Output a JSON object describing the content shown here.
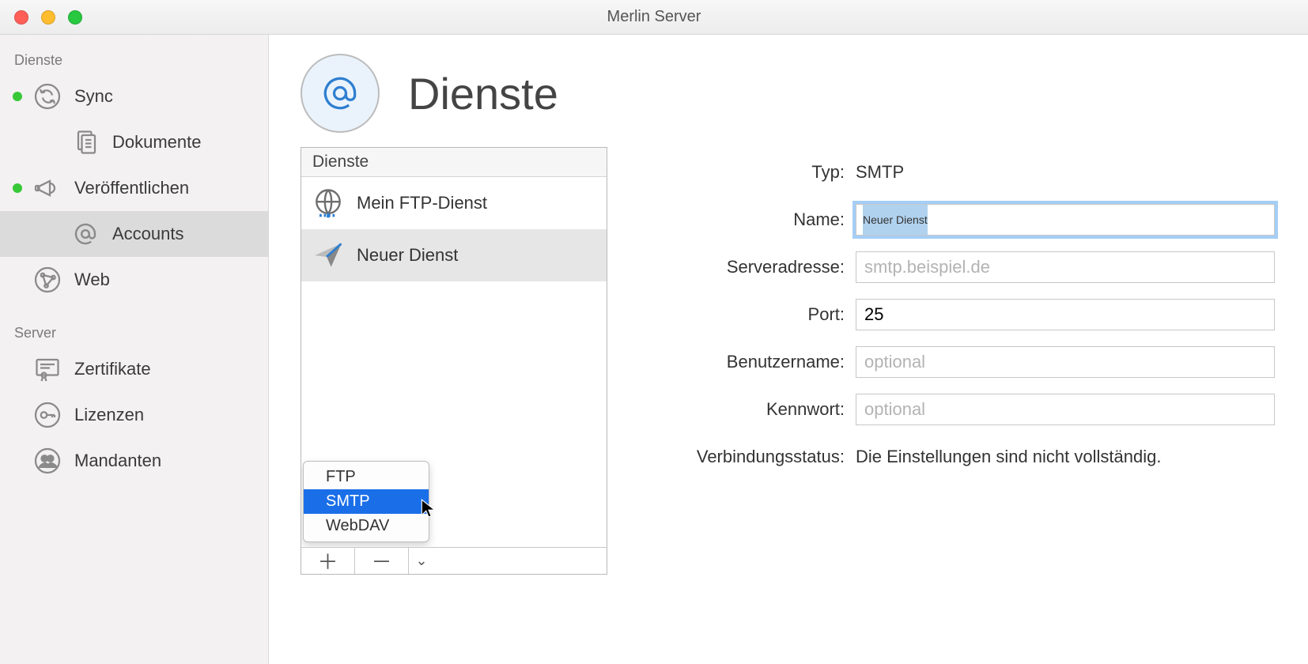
{
  "window": {
    "title": "Merlin Server"
  },
  "sidebar": {
    "sections": [
      {
        "label": "Dienste",
        "items": [
          {
            "label": "Sync",
            "status": "on"
          },
          {
            "label": "Dokumente",
            "sub": true
          },
          {
            "label": "Veröffentlichen",
            "status": "on"
          },
          {
            "label": "Accounts",
            "sub": true,
            "selected": true
          },
          {
            "label": "Web"
          }
        ]
      },
      {
        "label": "Server",
        "items": [
          {
            "label": "Zertifikate"
          },
          {
            "label": "Lizenzen"
          },
          {
            "label": "Mandanten"
          }
        ]
      }
    ]
  },
  "header": {
    "title": "Dienste"
  },
  "serviceBox": {
    "header": "Dienste",
    "items": [
      {
        "label": "Mein FTP-Dienst"
      },
      {
        "label": "Neuer Dienst",
        "selected": true
      }
    ],
    "dropdown": {
      "items": [
        {
          "label": "FTP"
        },
        {
          "label": "SMTP",
          "selected": true
        },
        {
          "label": "WebDAV"
        }
      ]
    }
  },
  "form": {
    "typeLabel": "Typ:",
    "typeValue": "SMTP",
    "nameLabel": "Name:",
    "nameValue": "Neuer Dienst",
    "serverLabel": "Serveradresse:",
    "serverPlaceholder": "smtp.beispiel.de",
    "serverValue": "",
    "portLabel": "Port:",
    "portValue": "25",
    "userLabel": "Benutzername:",
    "userPlaceholder": "optional",
    "userValue": "",
    "passLabel": "Kennwort:",
    "passPlaceholder": "optional",
    "passValue": "",
    "statusLabel": "Verbindungsstatus:",
    "statusValue": "Die Einstellungen sind nicht vollständig."
  }
}
